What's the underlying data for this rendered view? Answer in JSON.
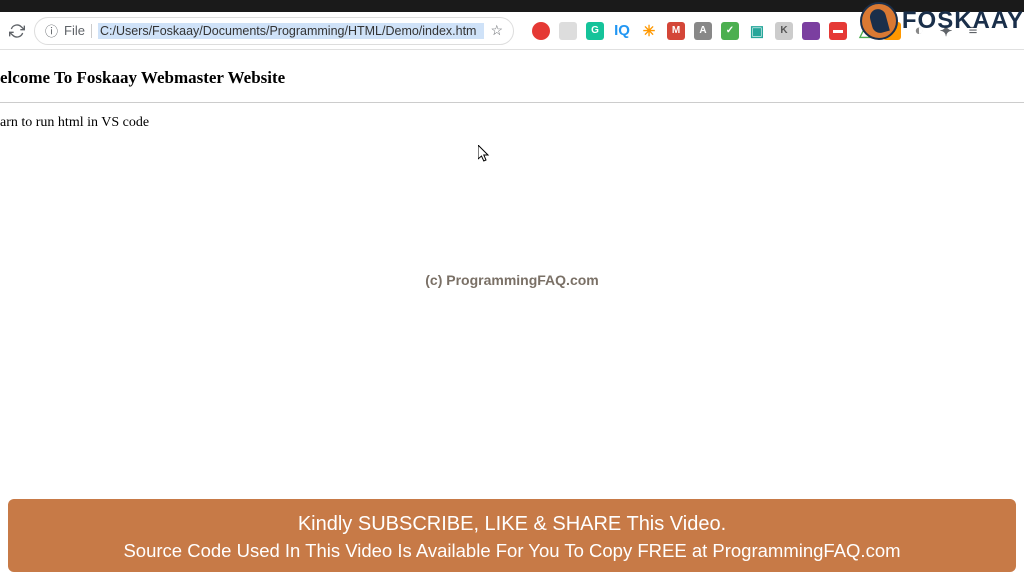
{
  "logo": {
    "text": "FOSKAAY"
  },
  "toolbar": {
    "file_label": "File",
    "url": "C:/Users/Foskaay/Documents/Programming/HTML/Demo/index.htm"
  },
  "extensions": [
    {
      "name": "red-circle",
      "bg": "#e53935",
      "txt": ""
    },
    {
      "name": "gray-box",
      "bg": "#ddd",
      "txt": ""
    },
    {
      "name": "grammarly",
      "bg": "#15c39a",
      "txt": "G"
    },
    {
      "name": "iq",
      "bg": "transparent",
      "txt": "IQ",
      "color": "#2196f3"
    },
    {
      "name": "orange-bug",
      "bg": "transparent",
      "txt": "✳",
      "color": "#ff9800"
    },
    {
      "name": "gmail",
      "bg": "#d44638",
      "txt": "M"
    },
    {
      "name": "gray-a",
      "bg": "#888",
      "txt": "A"
    },
    {
      "name": "shield",
      "bg": "#4caf50",
      "txt": "✓"
    },
    {
      "name": "teal-box",
      "bg": "transparent",
      "txt": "▣",
      "color": "#26a69a"
    },
    {
      "name": "k-circle",
      "bg": "#ccc",
      "txt": "K",
      "color": "#555"
    },
    {
      "name": "purple-box",
      "bg": "#7b3fa0",
      "txt": ""
    },
    {
      "name": "red-chart",
      "bg": "#e53935",
      "txt": "▬"
    },
    {
      "name": "drive",
      "bg": "transparent",
      "txt": "△",
      "color": "#4caf50"
    },
    {
      "name": "orange-circle",
      "bg": "#ff9800",
      "txt": "●"
    },
    {
      "name": "s-icon",
      "bg": "transparent",
      "txt": "◐",
      "color": "#888"
    },
    {
      "name": "puzzle",
      "bg": "transparent",
      "txt": "✦",
      "color": "#5f6368"
    },
    {
      "name": "list",
      "bg": "transparent",
      "txt": "≡",
      "color": "#5f6368"
    }
  ],
  "page": {
    "title": "elcome To Foskaay Webmaster Website",
    "body": "arn to run html in VS code"
  },
  "watermark": "(c) ProgrammingFAQ.com",
  "banner": {
    "line1": "Kindly SUBSCRIBE, LIKE & SHARE This Video.",
    "line2": "Source Code Used In This Video Is Available For You To Copy  FREE at  ProgrammingFAQ.com"
  }
}
